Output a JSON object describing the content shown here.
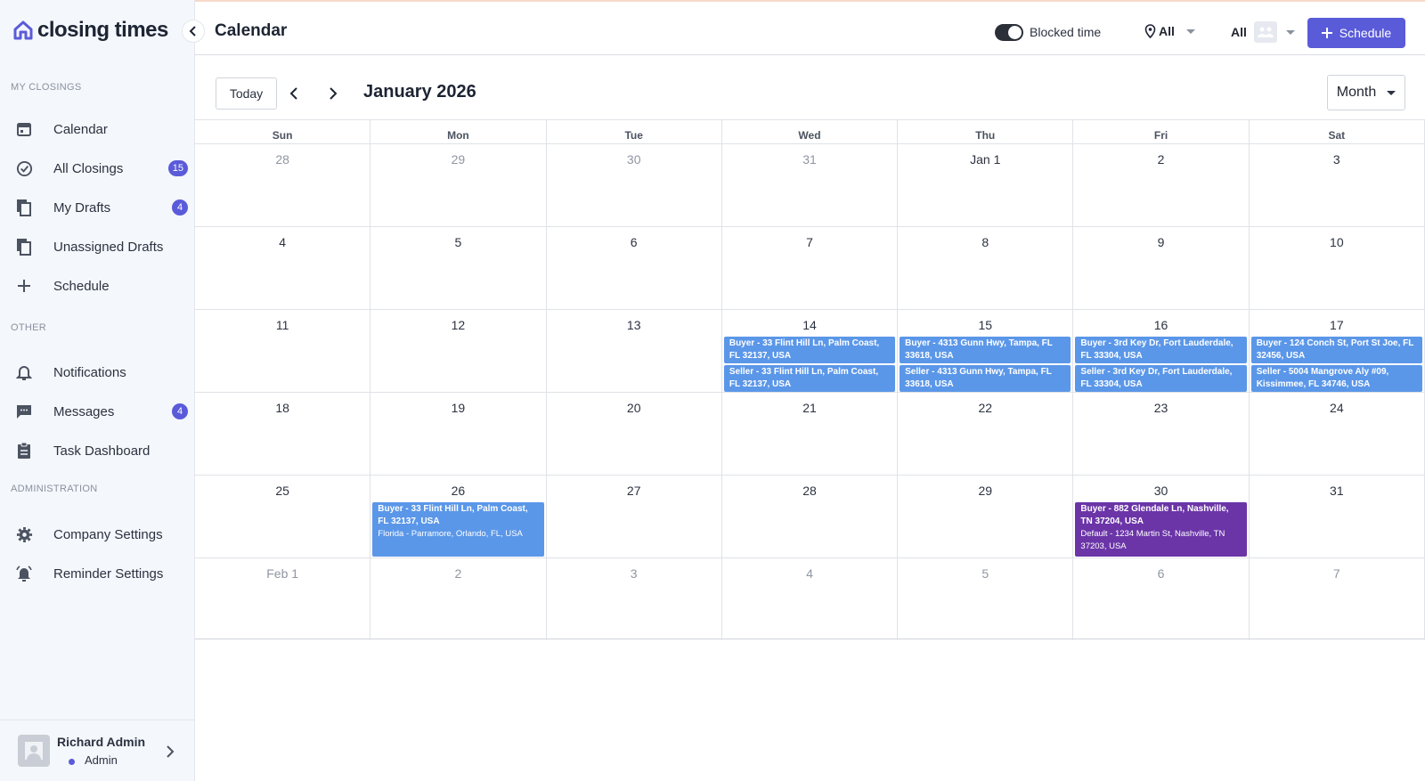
{
  "app": {
    "brand": "closing times",
    "colors": {
      "accent": "#5a5bd9",
      "event_blue": "#5b97e8",
      "event_purple": "#6b35a8"
    }
  },
  "sidebar": {
    "sections": {
      "my_closings": "MY CLOSINGS",
      "other": "OTHER",
      "administration": "ADMINISTRATION"
    },
    "items": [
      {
        "label": "Calendar",
        "icon": "calendar-icon"
      },
      {
        "label": "All Closings",
        "icon": "check-circle-icon",
        "badge": "15"
      },
      {
        "label": "My Drafts",
        "icon": "documents-icon",
        "badge": "4"
      },
      {
        "label": "Unassigned Drafts",
        "icon": "documents-icon"
      },
      {
        "label": "Schedule",
        "icon": "plus-icon"
      },
      {
        "label": "Notifications",
        "icon": "bell-icon"
      },
      {
        "label": "Messages",
        "icon": "chat-icon",
        "badge": "4"
      },
      {
        "label": "Task Dashboard",
        "icon": "clipboard-icon"
      },
      {
        "label": "Company Settings",
        "icon": "gear-icon"
      },
      {
        "label": "Reminder Settings",
        "icon": "alarm-bell-icon"
      }
    ],
    "user": {
      "name": "Richard Admin",
      "role": "Admin"
    }
  },
  "header": {
    "title": "Calendar",
    "blocked_time_label": "Blocked time",
    "blocked_time_on": true,
    "location_filter": "All",
    "people_filter": "All",
    "schedule_button": "Schedule"
  },
  "calendar": {
    "today_button": "Today",
    "month_title": "January 2026",
    "view": "Month",
    "weekdays": [
      "Sun",
      "Mon",
      "Tue",
      "Wed",
      "Thu",
      "Fri",
      "Sat"
    ],
    "weeks": [
      [
        "28",
        "29",
        "30",
        "31",
        "Jan 1",
        "2",
        "3"
      ],
      [
        "4",
        "5",
        "6",
        "7",
        "8",
        "9",
        "10"
      ],
      [
        "11",
        "12",
        "13",
        "14",
        "15",
        "16",
        "17"
      ],
      [
        "18",
        "19",
        "20",
        "21",
        "22",
        "23",
        "24"
      ],
      [
        "25",
        "26",
        "27",
        "28",
        "29",
        "30",
        "31"
      ],
      [
        "Feb 1",
        "2",
        "3",
        "4",
        "5",
        "6",
        "7"
      ]
    ],
    "events": {
      "w2d3a": "Buyer - 33 Flint Hill Ln, Palm Coast, FL 32137, USA",
      "w2d3b": "Seller - 33 Flint Hill Ln, Palm Coast, FL 32137, USA",
      "w2d4a": "Buyer - 4313 Gunn Hwy, Tampa, FL 33618, USA",
      "w2d4b": "Seller - 4313 Gunn Hwy, Tampa, FL 33618, USA",
      "w2d5a": "Buyer - 3rd Key Dr, Fort Lauderdale, FL 33304, USA",
      "w2d5b": "Seller - 3rd Key Dr, Fort Lauderdale, FL 33304, USA",
      "w2d6a": "Buyer - 124 Conch St, Port St Joe, FL 32456, USA",
      "w2d6b": "Seller - 5004 Mangrove Aly #09, Kissimmee, FL 34746, USA",
      "w4d1_title": "Buyer - 33 Flint Hill Ln, Palm Coast, FL 32137, USA",
      "w4d1_sub": "Florida - Parramore, Orlando, FL, USA",
      "w4d5_title": "Buyer - 882 Glendale Ln, Nashville, TN 37204, USA",
      "w4d5_sub": "Default - 1234 Martin St, Nashville, TN 37203, USA"
    }
  }
}
